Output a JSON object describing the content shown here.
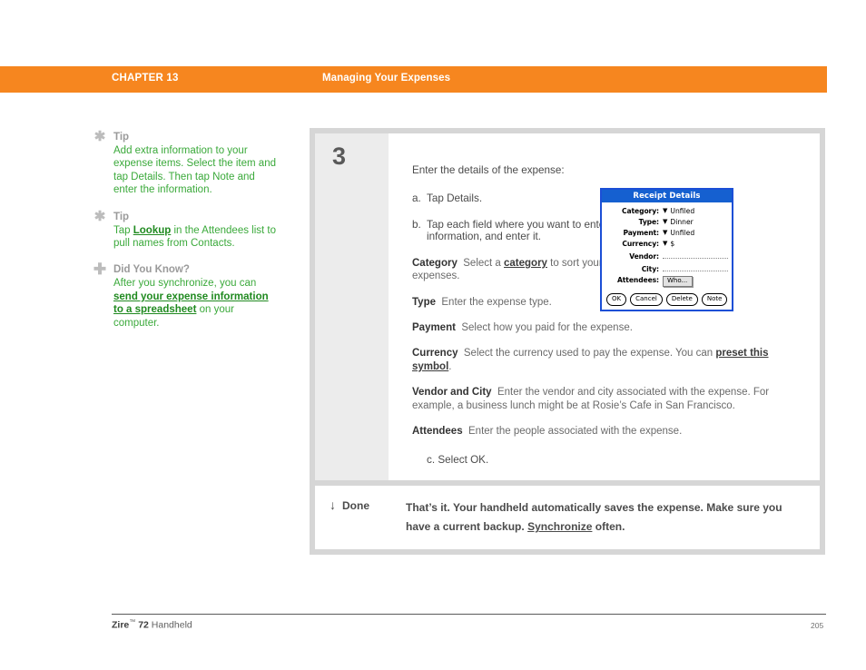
{
  "header": {
    "chapter_label": "CHAPTER 13",
    "chapter_title": "Managing Your Expenses",
    "bar_color": "#f6861f"
  },
  "sidebar": {
    "blocks": [
      {
        "icon": "asterisk-icon",
        "glyph": "✱",
        "heading": "Tip",
        "body_pre": "Add extra information to your expense items. Select the item and tap Details. Then tap Note and enter the information.",
        "link": "",
        "body_post": ""
      },
      {
        "icon": "asterisk-icon",
        "glyph": "✱",
        "heading": "Tip",
        "body_pre": "Tap ",
        "link": "Lookup",
        "body_post": " in the Attendees list to pull names from Contacts."
      },
      {
        "icon": "plus-icon",
        "glyph": "✚",
        "heading": "Did You Know?",
        "body_pre": "After you synchronize, you can ",
        "link": "send your expense information to a spreadsheet",
        "body_post": " on your computer."
      }
    ]
  },
  "step": {
    "number": "3",
    "intro": "Enter the details of the expense:",
    "sub_a": {
      "marker": "a.",
      "text": "Tap Details."
    },
    "sub_b": {
      "marker": "b.",
      "text": "Tap each field where you want to enter information, and enter it."
    },
    "fields": [
      {
        "name": "Category",
        "pre": "Select a ",
        "link": "category",
        "post": " to sort your expenses."
      },
      {
        "name": "Type",
        "pre": "Enter the expense type.",
        "link": "",
        "post": ""
      },
      {
        "name": "Payment",
        "pre": "Select how you paid for the expense.",
        "link": "",
        "post": ""
      },
      {
        "name": "Currency",
        "pre": "Select the currency used to pay the expense. You can ",
        "link": "preset this symbol",
        "post": "."
      },
      {
        "name": "Vendor and City",
        "pre": "Enter the vendor and city associated with the expense. For example, a business lunch might be at Rosie’s Cafe in San Francisco.",
        "link": "",
        "post": ""
      },
      {
        "name": "Attendees",
        "pre": "Enter the people associated with the expense.",
        "link": "",
        "post": ""
      }
    ],
    "sub_c": {
      "marker": "c.",
      "text": "Select OK."
    }
  },
  "dialog": {
    "title": "Receipt Details",
    "title_bg": "#1560d0",
    "border_color": "#1b4fd6",
    "rows": [
      {
        "label": "Category:",
        "value": "Unfiled",
        "has_caret": true
      },
      {
        "label": "Type:",
        "value": "Dinner",
        "has_caret": true
      },
      {
        "label": "Payment:",
        "value": "Unfiled",
        "has_caret": true
      },
      {
        "label": "Currency:",
        "value": "$",
        "has_caret": true
      },
      {
        "label": "Vendor:",
        "value": "",
        "has_caret": false
      },
      {
        "label": "City:",
        "value": "",
        "has_caret": false
      },
      {
        "label": "Attendees:",
        "value": "Who...",
        "has_caret": false
      }
    ],
    "buttons": [
      "OK",
      "Cancel",
      "Delete",
      "Note"
    ]
  },
  "done": {
    "arrow_glyph": "↓",
    "label": "Done",
    "pre": "That’s it. Your handheld automatically saves the expense. Make sure you have a current backup. ",
    "link": "Synchronize",
    "post": " often."
  },
  "footer": {
    "brand": "Zire",
    "trademark": "™",
    "model": "72",
    "product": "Handheld",
    "page_number": "205"
  }
}
